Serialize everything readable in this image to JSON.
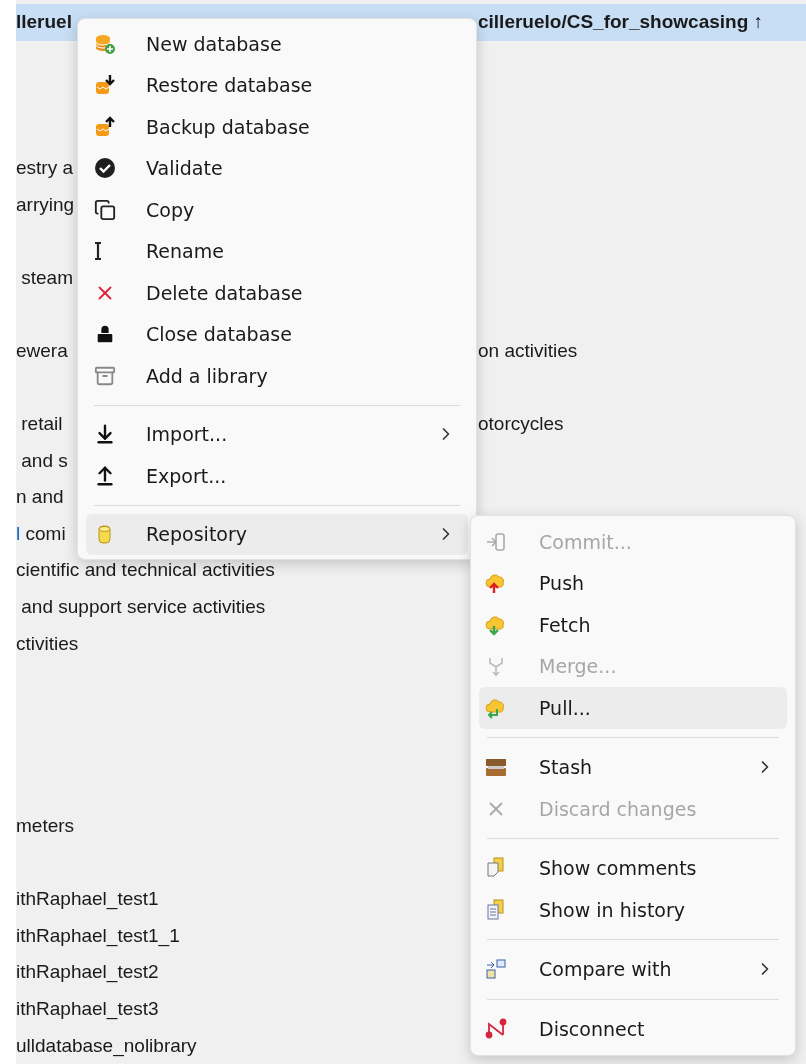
{
  "tree": {
    "rows": [
      {
        "kind": "split",
        "left": "lleruel",
        "right": "cilleruelo/CS_for_showcasing ↑",
        "selected": true
      },
      {
        "kind": "covered"
      },
      {
        "kind": "covered"
      },
      {
        "kind": "covered"
      },
      {
        "kind": "split",
        "left": "estry a",
        "selected": false
      },
      {
        "kind": "split",
        "left": "arrying",
        "selected": false
      },
      {
        "kind": "covered"
      },
      {
        "kind": "split",
        "left": " steam",
        "selected": false
      },
      {
        "kind": "covered"
      },
      {
        "kind": "split",
        "left": "ewera",
        "right": "on activities",
        "selected": false
      },
      {
        "kind": "covered"
      },
      {
        "kind": "split",
        "left": " retail",
        "right": "otorcycles",
        "selected": false
      },
      {
        "kind": "split",
        "left": " and s",
        "selected": false
      },
      {
        "kind": "split",
        "left": "n and",
        "selected": false
      },
      {
        "kind": "split",
        "accent": "l",
        "left": " comi",
        "selected": false
      },
      {
        "kind": "full",
        "left": "cientific and technical activities",
        "selected": false
      },
      {
        "kind": "full",
        "left": " and support service activities",
        "selected": false
      },
      {
        "kind": "full",
        "left": "ctivities",
        "selected": false
      },
      {
        "kind": "covered"
      },
      {
        "kind": "covered"
      },
      {
        "kind": "covered"
      },
      {
        "kind": "covered"
      },
      {
        "kind": "full",
        "left": "meters",
        "selected": false
      },
      {
        "kind": "covered"
      },
      {
        "kind": "full",
        "left": "ithRaphael_test1",
        "selected": false
      },
      {
        "kind": "full",
        "left": "ithRaphael_test1_1",
        "selected": false
      },
      {
        "kind": "full",
        "left": "ithRaphael_test2",
        "selected": false
      },
      {
        "kind": "full",
        "left": "ithRaphael_test3",
        "selected": false
      },
      {
        "kind": "full",
        "left": "ulldatabase_nolibrary",
        "selected": false
      }
    ]
  },
  "context_menu": {
    "items": [
      {
        "kind": "item",
        "label": "New database",
        "submenu": false,
        "selected": false
      },
      {
        "kind": "item",
        "label": "Restore database",
        "submenu": false,
        "selected": false
      },
      {
        "kind": "item",
        "label": "Backup database",
        "submenu": false,
        "selected": false
      },
      {
        "kind": "item",
        "label": "Validate",
        "submenu": false,
        "selected": false
      },
      {
        "kind": "item",
        "label": "Copy",
        "submenu": false,
        "selected": false
      },
      {
        "kind": "item",
        "label": "Rename",
        "submenu": false,
        "selected": false
      },
      {
        "kind": "item",
        "label": "Delete database",
        "submenu": false,
        "selected": false
      },
      {
        "kind": "item",
        "label": "Close database",
        "submenu": false,
        "selected": false
      },
      {
        "kind": "item",
        "label": "Add a library",
        "submenu": false,
        "selected": false
      },
      {
        "kind": "separator"
      },
      {
        "kind": "item",
        "label": "Import...",
        "submenu": true,
        "selected": false
      },
      {
        "kind": "item",
        "label": "Export...",
        "submenu": false,
        "selected": false
      },
      {
        "kind": "separator"
      },
      {
        "kind": "item",
        "label": "Repository",
        "submenu": true,
        "selected": true
      }
    ]
  },
  "repository_submenu": {
    "items": [
      {
        "kind": "item",
        "label": "Commit...",
        "submenu": false,
        "selected": false,
        "disabled": true
      },
      {
        "kind": "item",
        "label": "Push",
        "submenu": false,
        "selected": false,
        "disabled": false
      },
      {
        "kind": "item",
        "label": "Fetch",
        "submenu": false,
        "selected": false,
        "disabled": false
      },
      {
        "kind": "item",
        "label": "Merge...",
        "submenu": false,
        "selected": false,
        "disabled": true
      },
      {
        "kind": "item",
        "label": "Pull...",
        "submenu": false,
        "selected": true,
        "disabled": false
      },
      {
        "kind": "separator"
      },
      {
        "kind": "item",
        "label": "Stash",
        "submenu": true,
        "selected": false,
        "disabled": false
      },
      {
        "kind": "item",
        "label": "Discard changes",
        "submenu": false,
        "selected": false,
        "disabled": true
      },
      {
        "kind": "separator"
      },
      {
        "kind": "item",
        "label": "Show comments",
        "submenu": false,
        "selected": false,
        "disabled": false
      },
      {
        "kind": "item",
        "label": "Show in history",
        "submenu": false,
        "selected": false,
        "disabled": false
      },
      {
        "kind": "separator"
      },
      {
        "kind": "item",
        "label": "Compare with",
        "submenu": true,
        "selected": false,
        "disabled": false
      },
      {
        "kind": "separator"
      },
      {
        "kind": "item",
        "label": "Disconnect",
        "submenu": false,
        "selected": false,
        "disabled": false
      }
    ]
  }
}
